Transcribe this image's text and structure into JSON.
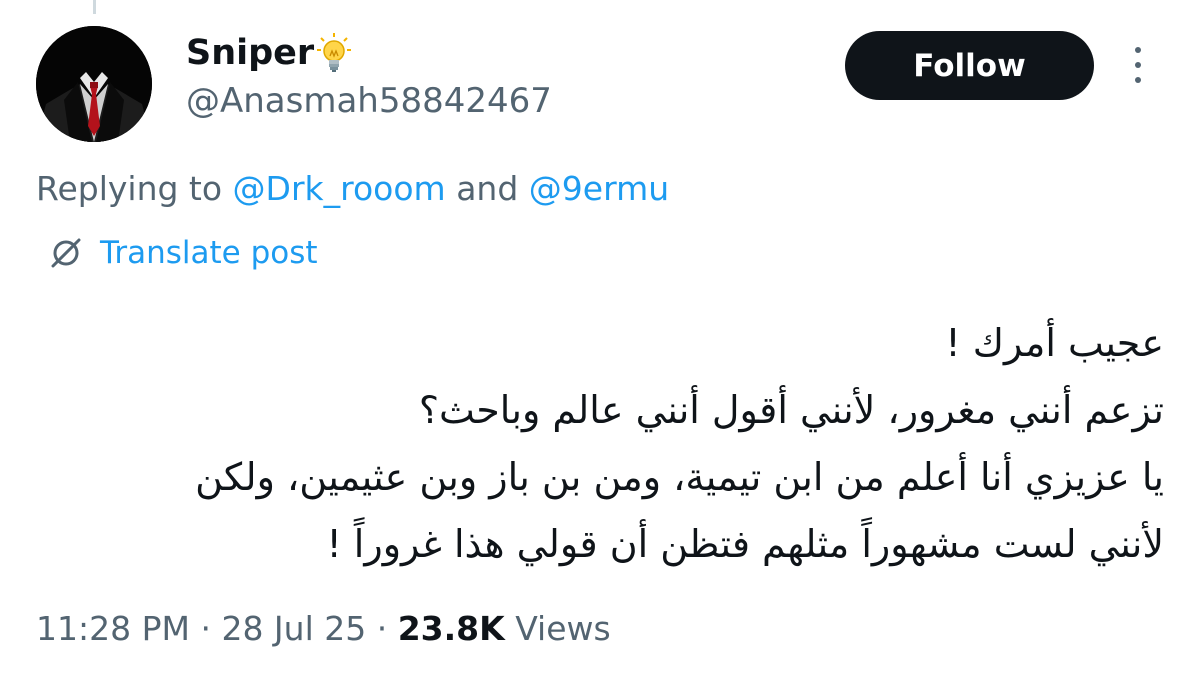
{
  "author": {
    "display_name": "Sniper",
    "badge_icon": "light-bulb-emoji",
    "handle": "@Anasmah58842467"
  },
  "follow_button": {
    "label": "Follow",
    "background": "#0f1419",
    "text_color": "#ffffff"
  },
  "more_icon": "more-vertical-icon",
  "replying": {
    "prefix": "Replying to ",
    "mention_1": "@Drk_rooom",
    "conjunction": " and ",
    "mention_2": "@9ermu"
  },
  "translate": {
    "icon": "globe-slash-icon",
    "label": "Translate post"
  },
  "tweet": {
    "lines": [
      "عجيب أمرك !",
      "تزعم أنني مغرور، لأنني أقول أنني عالم وباحث؟",
      "يا عزيزي أنا أعلم من ابن تيمية، ومن بن باز وبن عثيمين، ولكن",
      "لأنني لست مشهوراً مثلهم فتظن أن قولي هذا غروراً !"
    ]
  },
  "meta": {
    "time": "11:28 PM",
    "separator": " · ",
    "date": "28 Jul 25",
    "views_count": "23.8K",
    "views_label": " Views"
  },
  "colors": {
    "accent": "#1d9bf0",
    "secondary_text": "#536471",
    "primary_text": "#0f1419"
  }
}
